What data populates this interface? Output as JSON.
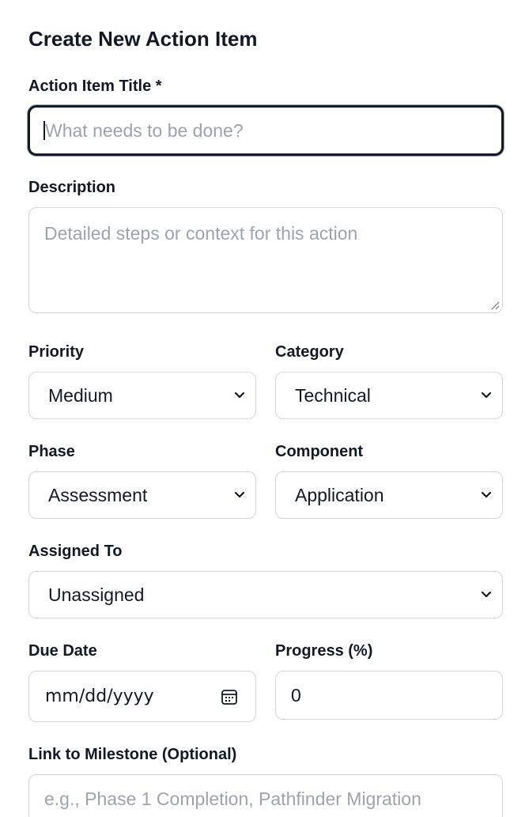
{
  "form": {
    "title": "Create New Action Item",
    "title_field": {
      "label": "Action Item Title *",
      "placeholder": "What needs to be done?",
      "value": ""
    },
    "description": {
      "label": "Description",
      "placeholder": "Detailed steps or context for this action",
      "value": ""
    },
    "priority": {
      "label": "Priority",
      "selected": "Medium"
    },
    "category": {
      "label": "Category",
      "selected": "Technical"
    },
    "phase": {
      "label": "Phase",
      "selected": "Assessment"
    },
    "component": {
      "label": "Component",
      "selected": "Application"
    },
    "assigned_to": {
      "label": "Assigned To",
      "selected": "Unassigned"
    },
    "due_date": {
      "label": "Due Date",
      "placeholder": "mm/dd/yyyy",
      "icon": "calendar-icon"
    },
    "progress": {
      "label": "Progress (%)",
      "value": "0"
    },
    "milestone": {
      "label": "Link to Milestone (Optional)",
      "placeholder": "e.g., Phase 1 Completion, Pathfinder Migration"
    }
  },
  "icons": {
    "select_chevron": "chevron-down-icon",
    "textarea_resize": "resize-handle-icon"
  },
  "colors": {
    "border": "#d1d5db",
    "focus_border": "#111827",
    "placeholder": "#9ca3af",
    "text": "#111827"
  }
}
